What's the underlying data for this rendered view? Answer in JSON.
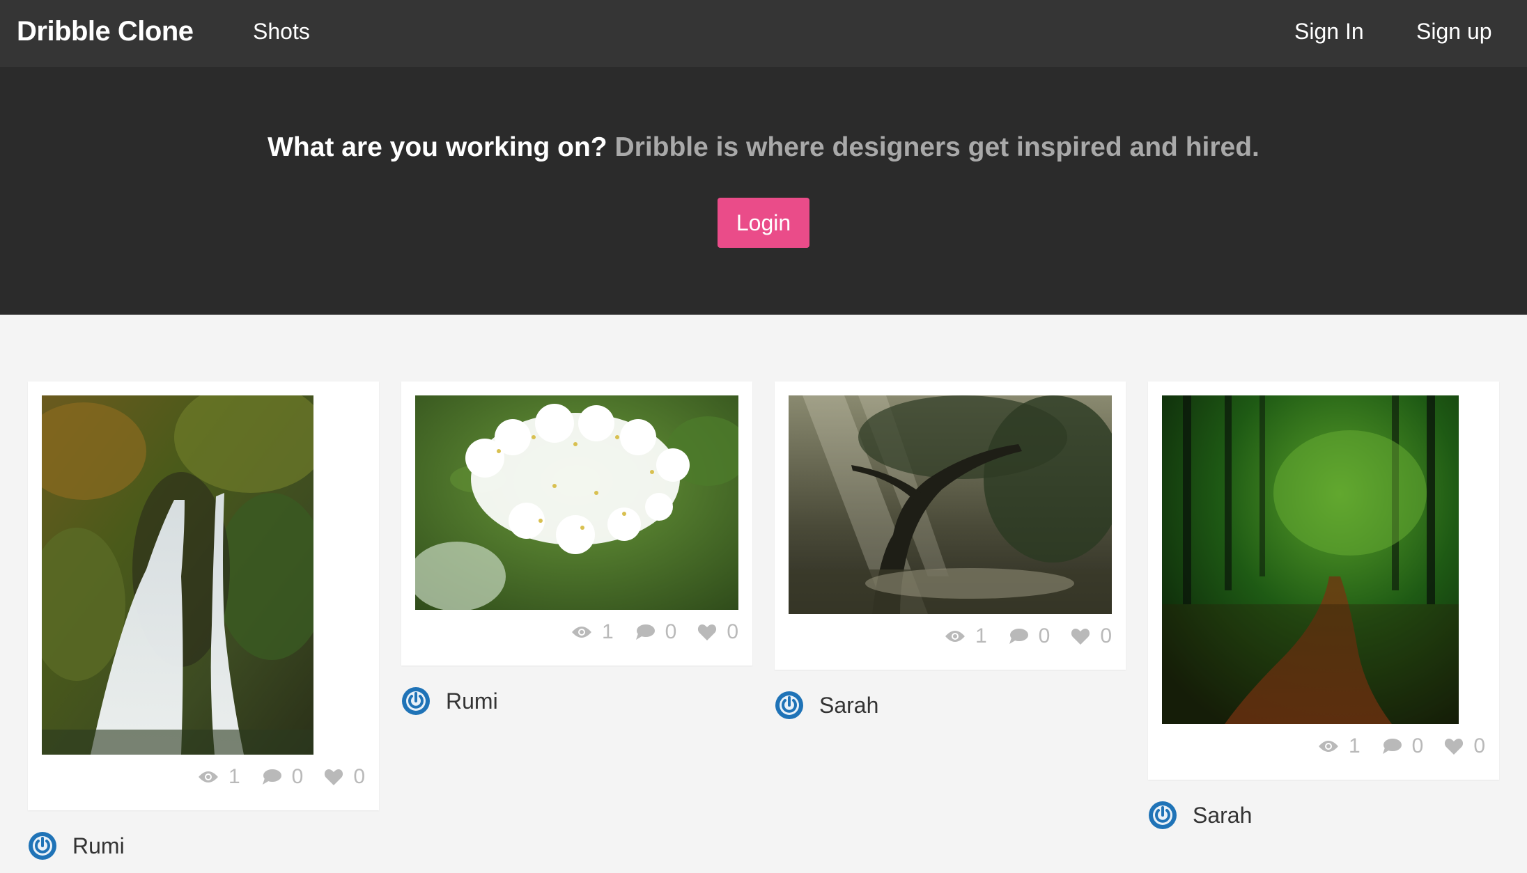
{
  "navbar": {
    "brand": "Dribble Clone",
    "links": [
      "Shots"
    ],
    "sign_in": "Sign In",
    "sign_up": "Sign up"
  },
  "hero": {
    "headline": "What are you working on?",
    "subline": "Dribble is where designers get inspired and hired.",
    "login_label": "Login"
  },
  "shots": [
    {
      "image": "waterfall-photo",
      "views": "1",
      "comments": "0",
      "likes": "0",
      "author": "Rumi"
    },
    {
      "image": "white-flowers-photo",
      "views": "1",
      "comments": "0",
      "likes": "0",
      "author": "Rumi"
    },
    {
      "image": "sunlit-tree-photo",
      "views": "1",
      "comments": "0",
      "likes": "0",
      "author": "Sarah"
    },
    {
      "image": "forest-path-photo",
      "views": "1",
      "comments": "0",
      "likes": "0",
      "author": "Sarah"
    }
  ],
  "colors": {
    "navbar_bg": "#353535",
    "hero_bg": "#2b2b2b",
    "accent": "#ea4c89",
    "page_bg": "#f4f4f4",
    "avatar_blue": "#1f73b7"
  },
  "icons": {
    "views": "eye-icon",
    "comments": "comment-icon",
    "likes": "heart-icon",
    "avatar": "power-avatar-icon"
  }
}
